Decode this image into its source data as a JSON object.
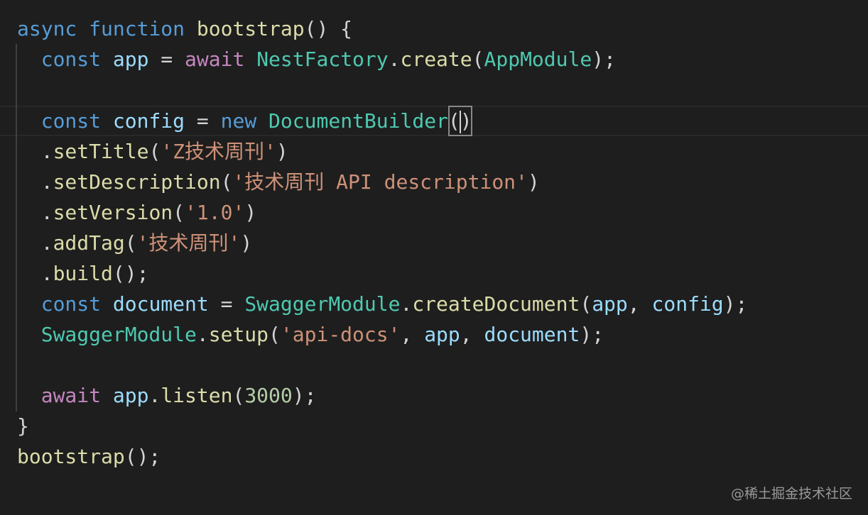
{
  "code": {
    "l1": {
      "kw_async": "async",
      "kw_function": "function",
      "fn_name": "bootstrap",
      "rest": "() {"
    },
    "l2": {
      "kw_const": "const",
      "var_app": "app",
      "eq": " = ",
      "kw_await": "await",
      "cls": "NestFactory",
      "dot": ".",
      "method": "create",
      "open": "(",
      "arg": "AppModule",
      "close": ");"
    },
    "l4": {
      "kw_const": "const",
      "var_config": "config",
      "eq": " = ",
      "kw_new": "new",
      "cls": "DocumentBuilder",
      "open": "(",
      "close": ")"
    },
    "l5": {
      "dot": ".",
      "method": "setTitle",
      "open": "(",
      "str": "'Z技术周刊'",
      "close": ")"
    },
    "l6": {
      "dot": ".",
      "method": "setDescription",
      "open": "(",
      "str": "'技术周刊 API description'",
      "close": ")"
    },
    "l7": {
      "dot": ".",
      "method": "setVersion",
      "open": "(",
      "str": "'1.0'",
      "close": ")"
    },
    "l8": {
      "dot": ".",
      "method": "addTag",
      "open": "(",
      "str": "'技术周刊'",
      "close": ")"
    },
    "l9": {
      "dot": ".",
      "method": "build",
      "close": "();"
    },
    "l10": {
      "kw_const": "const",
      "var_document": "document",
      "eq": " = ",
      "cls": "SwaggerModule",
      "dot": ".",
      "method": "createDocument",
      "open": "(",
      "arg1": "app",
      "comma": ", ",
      "arg2": "config",
      "close": ");"
    },
    "l11": {
      "cls": "SwaggerModule",
      "dot": ".",
      "method": "setup",
      "open": "(",
      "str": "'api-docs'",
      "comma1": ", ",
      "arg1": "app",
      "comma2": ", ",
      "arg2": "document",
      "close": ");"
    },
    "l13": {
      "kw_await": "await",
      "var_app": "app",
      "dot": ".",
      "method": "listen",
      "open": "(",
      "num": "3000",
      "close": ");"
    },
    "l14": {
      "brace": "}"
    },
    "l15": {
      "fn": "bootstrap",
      "close": "();"
    }
  },
  "watermark": "@稀土掘金技术社区",
  "colors": {
    "background": "#1e1e1e",
    "keyword_blue": "#569cd6",
    "keyword_purple": "#c586c0",
    "function": "#dcdcaa",
    "class": "#4ec9b0",
    "variable": "#9cdcfe",
    "string": "#ce9178",
    "number": "#b5cea8"
  }
}
